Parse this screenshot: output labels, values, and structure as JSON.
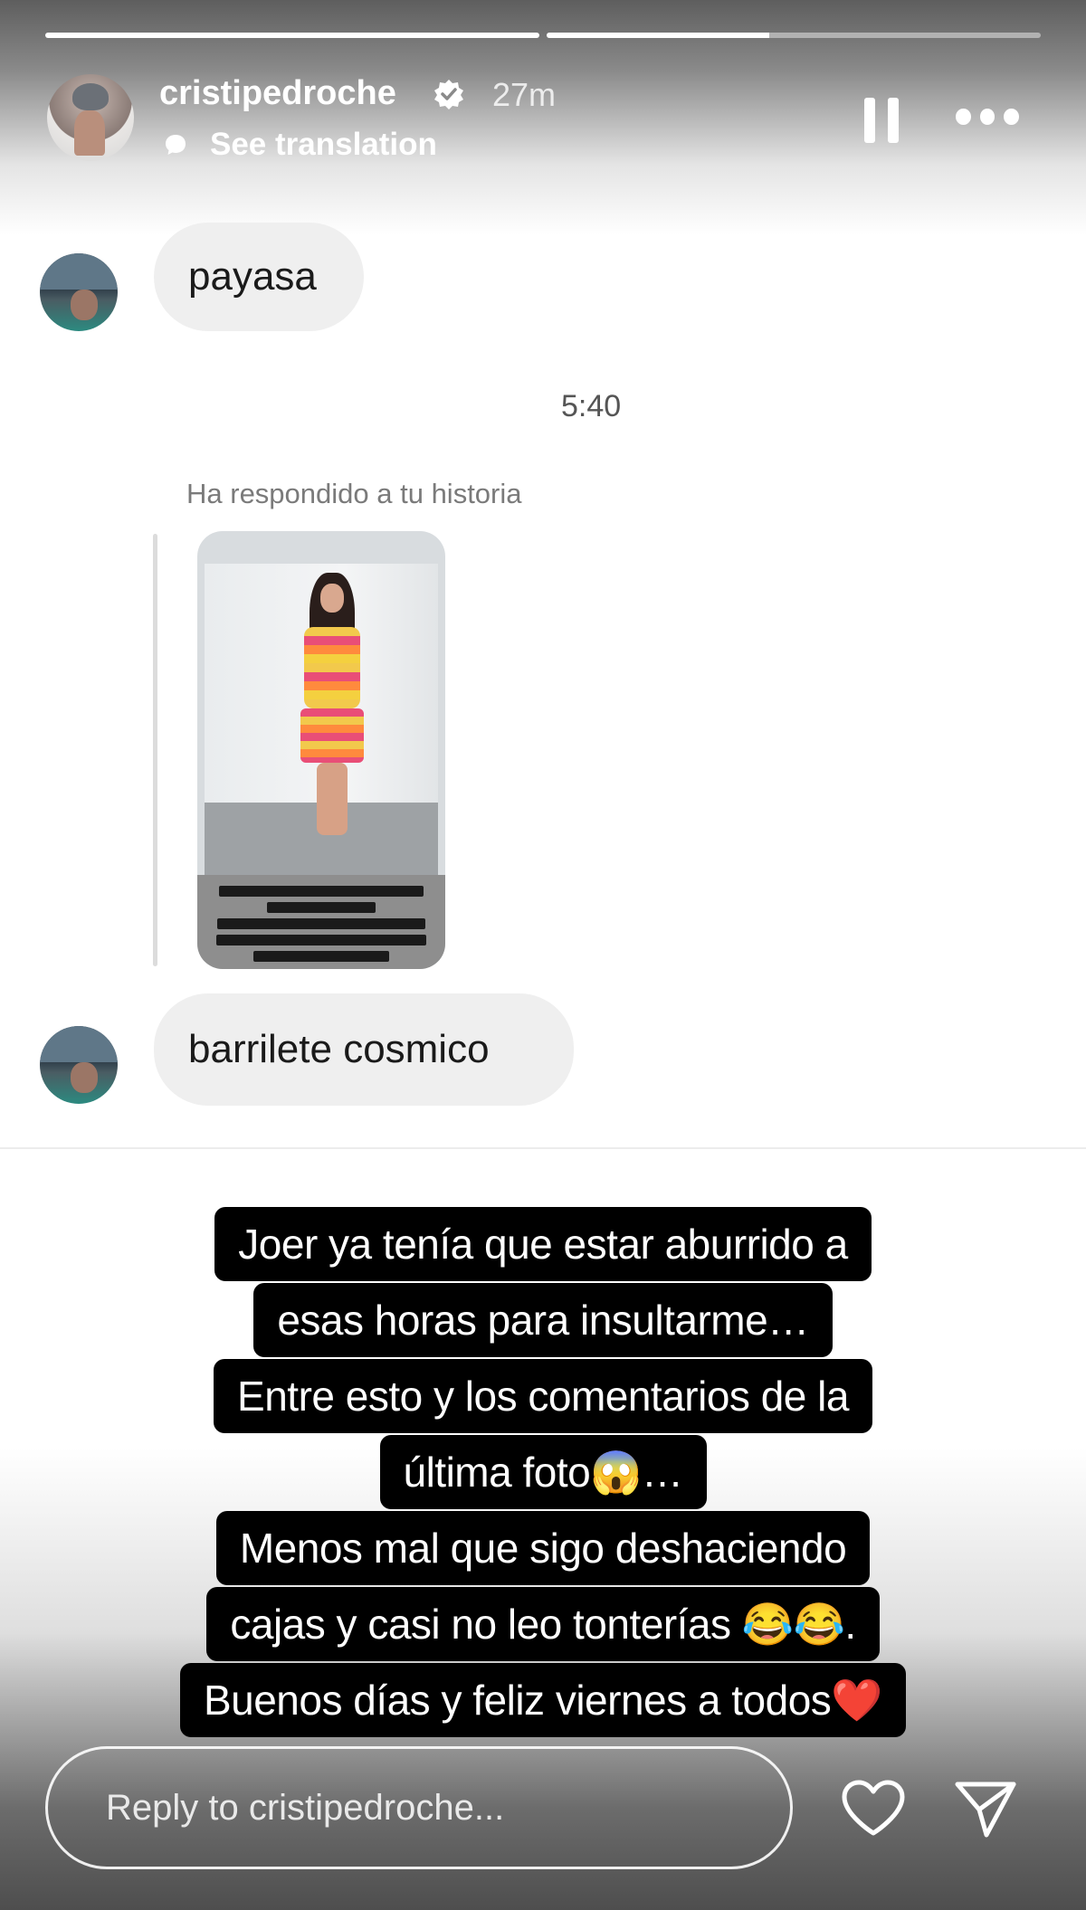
{
  "story": {
    "progress": [
      1.0,
      0.45
    ],
    "username": "cristipedroche",
    "time_ago": "27m",
    "see_translation": "See translation"
  },
  "chat": {
    "message_1": "payasa",
    "timestamp": "5:40",
    "replied_label": "Ha respondido a tu historia",
    "message_2": "barrilete cosmico"
  },
  "caption": {
    "lines": [
      "Joer ya tenía que estar aburrido a",
      "esas horas para insultarme…",
      "Entre esto y los comentarios de la",
      "última foto😱…",
      "Menos mal que sigo deshaciendo",
      "cajas y casi no leo tonterías 😂😂.",
      "Buenos días y feliz viernes a todos❤️"
    ]
  },
  "reply": {
    "placeholder": "Reply to cristipedroche..."
  },
  "icons": {
    "verified": "verified-badge-icon",
    "pause": "pause-icon",
    "more": "more-dots-icon",
    "like": "heart-icon",
    "send": "send-icon"
  }
}
